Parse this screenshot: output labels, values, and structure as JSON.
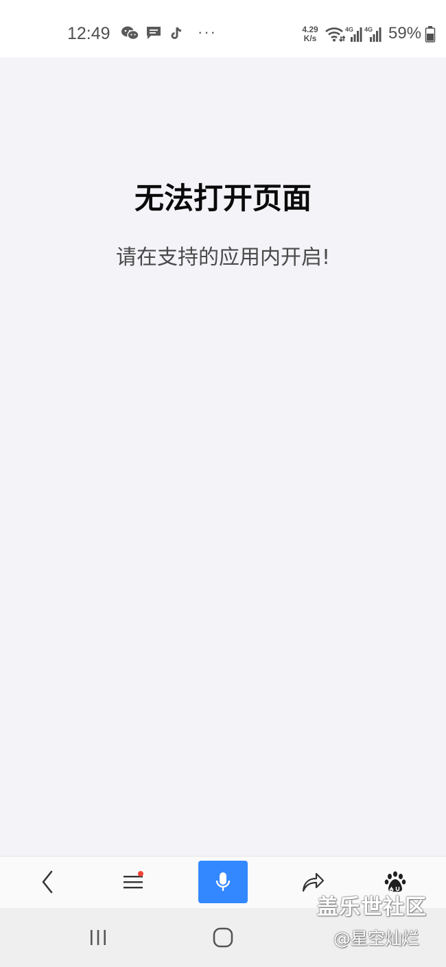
{
  "status_bar": {
    "time": "12:49",
    "notification_icons": [
      "wechat-icon",
      "message-icon",
      "tiktok-icon"
    ],
    "more": "···",
    "net_speed_value": "4.29",
    "net_speed_unit": "K/s",
    "signal_labels": [
      "4G",
      "4G"
    ],
    "battery_percent": "59%"
  },
  "main": {
    "title": "无法打开页面",
    "subtitle": "请在支持的应用内开启!"
  },
  "toolbar": {
    "buttons": [
      "back-icon",
      "menu-icon",
      "microphone-icon",
      "share-icon",
      "baidu-paw-icon"
    ],
    "voice_button_color": "#3388ff",
    "menu_badge_color": "#f04438"
  },
  "navbar": {
    "buttons": [
      "recent-apps-icon",
      "home-icon"
    ]
  },
  "watermark": {
    "line1": "盖乐世社区",
    "line2": "@星空灿烂"
  }
}
